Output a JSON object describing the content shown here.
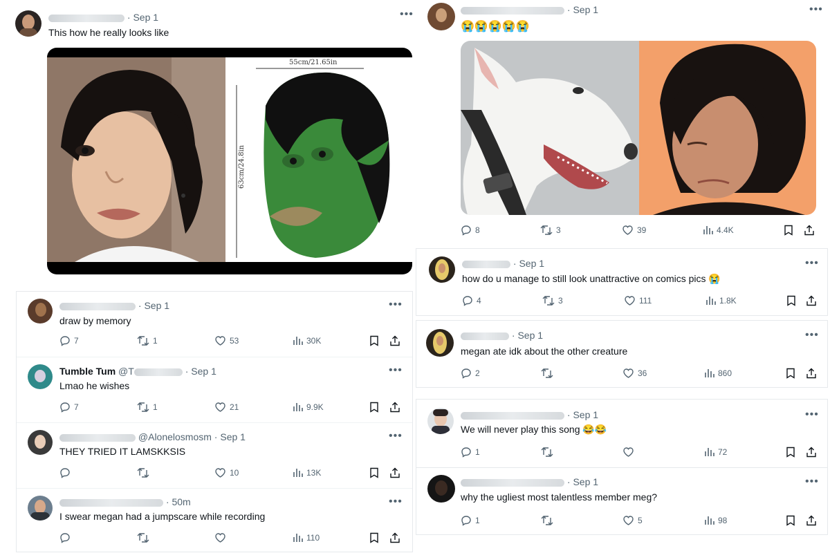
{
  "left": {
    "main": {
      "time": "Sep 1",
      "text": "This how he really looks like",
      "mask_dims": {
        "top": "55cm/21.65in",
        "side": "63cm/24.8in"
      }
    },
    "replies": [
      {
        "time": "Sep 1",
        "text": "draw by memory",
        "reply": "7",
        "retweet": "1",
        "like": "53",
        "views": "30K"
      },
      {
        "name": "Tumble Tum",
        "handle": "@T",
        "time": "Sep 1",
        "text": "Lmao he wishes",
        "reply": "7",
        "retweet": "1",
        "like": "21",
        "views": "9.9K"
      },
      {
        "handle": "@Alonelosmosm",
        "time": "Sep 1",
        "text": "THEY TRIED IT LAMSKKSIS",
        "reply": "",
        "retweet": "",
        "like": "10",
        "views": "13K"
      },
      {
        "time": "50m",
        "text": "I swear megan had a jumpscare while recording",
        "reply": "",
        "retweet": "",
        "like": "",
        "views": "110"
      }
    ]
  },
  "right": {
    "main": {
      "time": "Sep 1",
      "text": "😭😭😭😭😭",
      "reply": "8",
      "retweet": "3",
      "like": "39",
      "views": "4.4K"
    },
    "replies": [
      {
        "time": "Sep 1",
        "text": "how do u manage to still look unattractive on comics pics 😭",
        "reply": "4",
        "retweet": "3",
        "like": "111",
        "views": "1.8K"
      },
      {
        "time": "Sep 1",
        "text": "megan ate idk about the other creature",
        "reply": "2",
        "retweet": "",
        "like": "36",
        "views": "860"
      },
      {
        "time": "Sep 1",
        "text": "We will never play this song 😂😂",
        "reply": "1",
        "retweet": "",
        "like": "",
        "views": "72"
      },
      {
        "time": "Sep 1",
        "text": "why the ugliest most talentless member meg?",
        "reply": "1",
        "retweet": "",
        "like": "5",
        "views": "98"
      }
    ]
  },
  "icons": [
    "more-icon",
    "reply-icon",
    "retweet-icon",
    "like-icon",
    "views-icon",
    "bookmark-icon",
    "share-icon"
  ],
  "colors": {
    "text": "#0f1419",
    "secondary": "#536471",
    "mask_green": "#3a8a3a",
    "photo_bg": "#f3a06a"
  }
}
